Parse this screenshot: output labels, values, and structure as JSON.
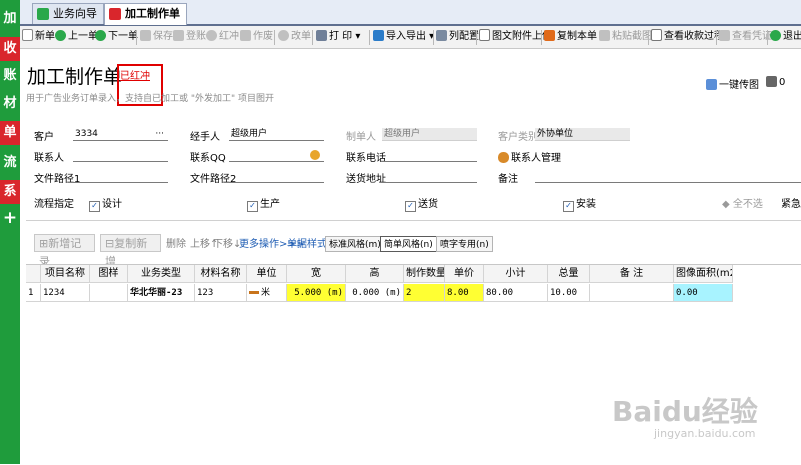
{
  "sidebar": {
    "items": [
      "加",
      "收",
      "账",
      "材",
      "单",
      "流",
      "系",
      "+"
    ]
  },
  "tabs": [
    {
      "label": "业务向导"
    },
    {
      "label": "加工制作单"
    }
  ],
  "toolbar": {
    "new": "新单",
    "prev": "上一单",
    "next": "下一单",
    "save": "保存",
    "post": "登账",
    "red": "红冲",
    "void": "作废",
    "edit": "改单",
    "print": "打 印",
    "import_export": "导入导出",
    "columns": "列配置",
    "upload": "图文附件上传",
    "copy": "复制本单",
    "paste": "粘贴截图",
    "receipts": "查看收款过程",
    "voucher": "查看凭证",
    "exit": "退出"
  },
  "header": {
    "title": "加工制作单",
    "status": "已红冲",
    "hint": "用于广告业务订单录入，支持自已加工或 \"外发加工\" 项目图开",
    "one_key": "一键传图",
    "print_count": "0"
  },
  "form": {
    "customer_label": "客户",
    "customer_value": "3334",
    "customer_more": "···",
    "handler_label": "经手人",
    "handler_value": "超级用户",
    "creator_label": "制单人",
    "creator_value": "超级用户",
    "category_label": "客户类别",
    "category_value": "外协单位",
    "contact_label": "联系人",
    "contact_value": "",
    "qq_label": "联系QQ",
    "qq_value": "",
    "phone_label": "联系电话",
    "phone_value": "",
    "contact_mgmt": "联系人管理",
    "path1_label": "文件路径1",
    "path1_value": "",
    "path2_label": "文件路径2",
    "path2_value": "",
    "address_label": "送货地址",
    "address_value": "",
    "note_label": "备注",
    "note_value": ""
  },
  "process": {
    "label": "流程指定",
    "options": [
      {
        "label": "设计",
        "checked": true
      },
      {
        "label": "生产",
        "checked": true
      },
      {
        "label": "送货",
        "checked": true
      },
      {
        "label": "安装",
        "checked": true
      }
    ],
    "select_none": "全不选",
    "urgent": "紧急"
  },
  "subbar": {
    "add": "新增记录",
    "copy_add": "复制新增",
    "delete": "删除",
    "up": "上移↑",
    "down": "下移↓",
    "more": "更多操作>>>",
    "style_label": "单据样式",
    "style_standard": "标准风格(m)",
    "style_simple": "简单风格(n)",
    "style_inkjet": "喷字专用(n)"
  },
  "table": {
    "headers": [
      "项目名称",
      "图样",
      "业务类型",
      "材料名称",
      "单位",
      "宽",
      "高",
      "制作数量",
      "单价",
      "小计",
      "总量",
      "备 注",
      "图像面积(m2)"
    ],
    "rows": [
      {
        "index": "1",
        "project": "1234",
        "pattern": "",
        "business": "华北华丽-23",
        "material": "123",
        "unit": "米",
        "width": "5.000 (m)",
        "height": "0.000 (m)",
        "qty": "2",
        "price": "8.00",
        "subtotal": "80.00",
        "total": "10.00",
        "remark": "",
        "area": "0.00"
      }
    ]
  },
  "watermark": {
    "main": "Baidu经验",
    "url": "jingyan.baidu.com"
  },
  "colors": {
    "sidebar": "#1f9c3c",
    "highlight": "#d9262c",
    "link": "#1e5cb3",
    "yellow": "#ffff33",
    "cyan": "#a8f3ff"
  }
}
